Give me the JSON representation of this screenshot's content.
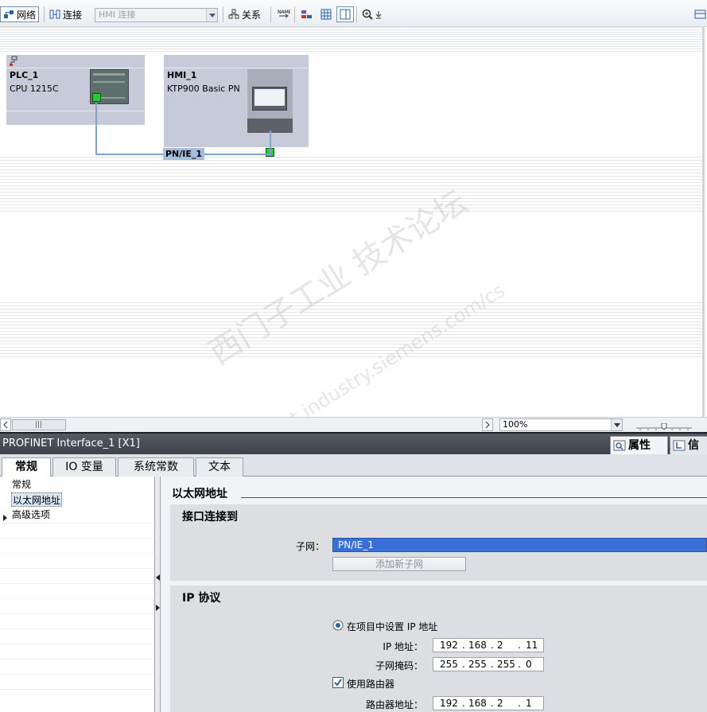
{
  "toolbar": {
    "network_label": "网络",
    "connection_label": "连接",
    "connection_combo_value": "HMI 连接",
    "relations_label": "关系"
  },
  "network": {
    "devices": [
      {
        "name": "PLC_1",
        "type": "CPU 1215C"
      },
      {
        "name": "HMI_1",
        "type": "KTP900 Basic PN"
      }
    ],
    "subnet_label": "PN/IE_1"
  },
  "zoom": {
    "value": "100%"
  },
  "watermark": {
    "line1": "西门子工业 技术论坛",
    "line2": "support.industry.siemens.com/cs"
  },
  "inspector": {
    "title": "PROFINET Interface_1 [X1]",
    "right_tabs": [
      "属性",
      "信息"
    ],
    "tabs": [
      "常规",
      "IO 变量",
      "系统常数",
      "文本"
    ],
    "nav": [
      "常规",
      "以太网地址",
      "高级选项"
    ],
    "section_ethernet": "以太网地址",
    "subsection_interface": "接口连接到",
    "subnet_label": "子网：",
    "subnet_value": "PN/IE_1",
    "add_subnet_button": "添加新子网",
    "subsection_ip": "IP 协议",
    "radio_set_in_project": "在项目中设置 IP 地址",
    "ip_label": "IP 地址：",
    "ip": [
      "192",
      "168",
      "2",
      "11"
    ],
    "mask_label": "子网掩码：",
    "mask": [
      "255",
      "255",
      "255",
      "0"
    ],
    "use_router_label": "使用路由器",
    "router_label": "路由器地址：",
    "router": [
      "192",
      "168",
      "2",
      "1"
    ]
  },
  "colors": {
    "device_bg": "#c7cad9",
    "subnet_line": "#7fa2c8",
    "port_green": "#22cc33",
    "selection_blue": "#3a6fd8"
  }
}
